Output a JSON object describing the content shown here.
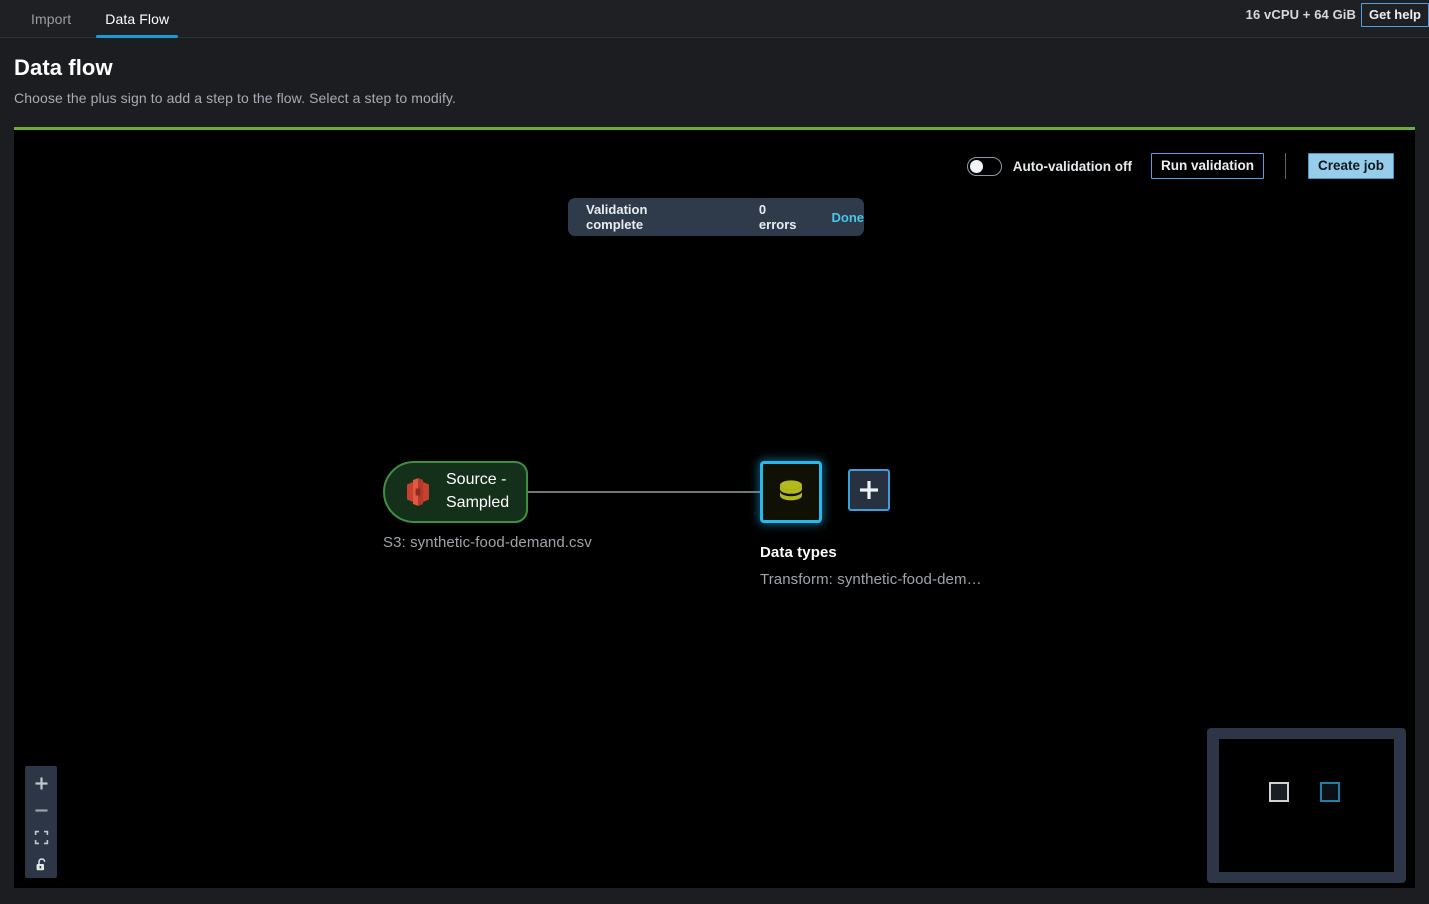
{
  "topbar": {
    "tabs": [
      {
        "label": "Import",
        "active": false
      },
      {
        "label": "Data Flow",
        "active": true
      }
    ],
    "capacity": "16 vCPU + 64 GiB",
    "help_button": "Get help"
  },
  "page": {
    "title": "Data flow",
    "subtitle": "Choose the plus sign to add a step to the flow. Select a step to modify."
  },
  "toolbar": {
    "auto_validation_label": "Auto-validation off",
    "auto_validation_on": false,
    "run_validation_label": "Run validation",
    "create_job_label": "Create job"
  },
  "toast": {
    "message": "Validation complete",
    "errors": "0 errors",
    "action": "Done"
  },
  "flow": {
    "source_node": {
      "label": "Source -\nSampled",
      "icon": "s3-bucket-icon",
      "caption": "S3: synthetic-food-demand.csv"
    },
    "transform_node": {
      "icon": "database-icon",
      "title": "Data types",
      "caption": "Transform: synthetic-food-dem…",
      "selected": true
    },
    "add_step_button": "+"
  },
  "zoom_controls": {
    "zoom_in": "zoom-in-icon",
    "zoom_out": "zoom-out-icon",
    "fit": "fit-to-screen-icon",
    "lock": "unlock-icon"
  },
  "colors": {
    "accent_blue": "#1c9ad6",
    "primary_button": "#96cdea",
    "canvas_border_green": "#6cae3e",
    "node_source_border": "#3f8f43",
    "node_selected_border": "#28b8f0",
    "toast_action": "#49c6e8",
    "s3_icon": "#c9412f",
    "db_icon": "#b3b81c"
  }
}
